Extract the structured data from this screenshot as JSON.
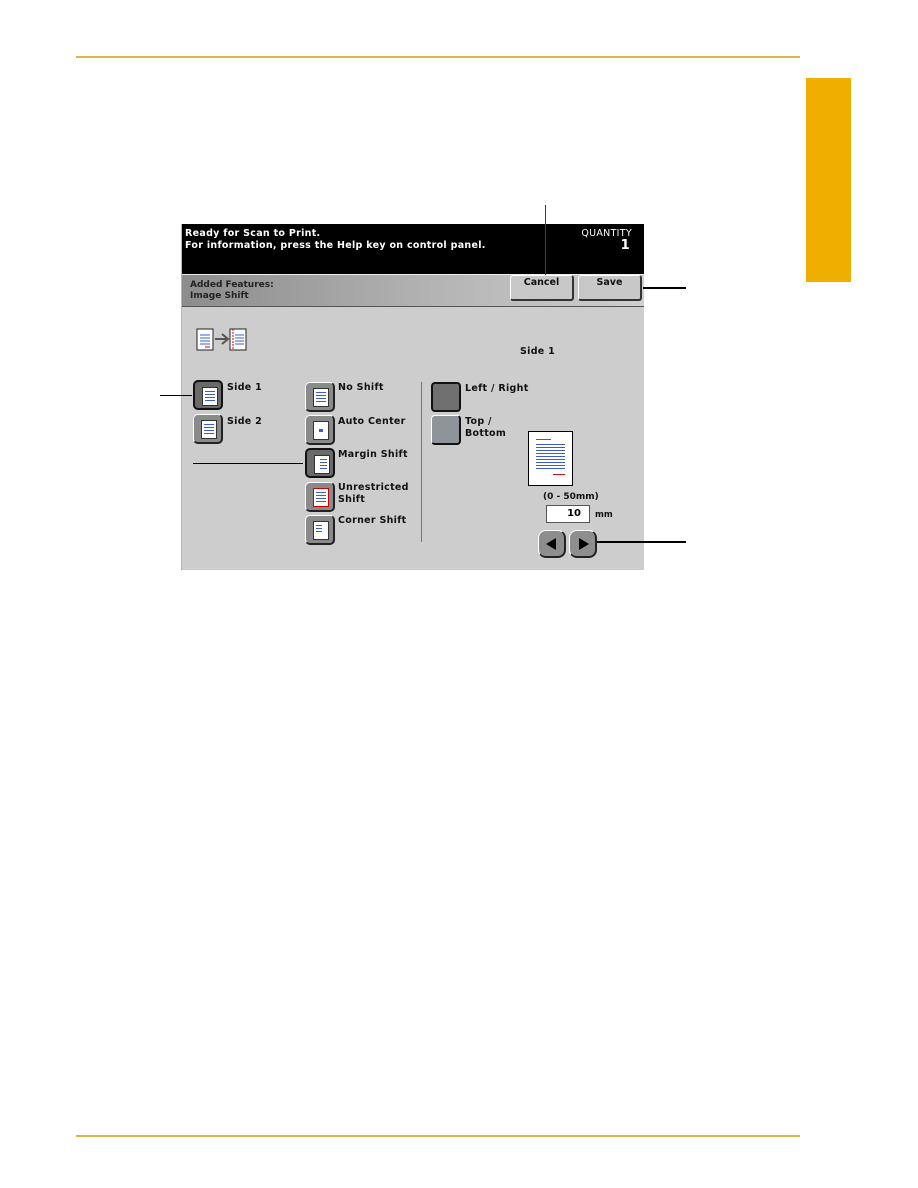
{
  "page": {
    "accent_color": "#efae00",
    "rule_color": "#d9b84a"
  },
  "screen": {
    "message_line1": "Ready  for  Scan  to  Print.",
    "message_line2": "For  information,  press  the  Help  key  on  control  panel.",
    "quantity_label": "QUANTITY",
    "quantity_value": "1",
    "title_line1": "Added  Features:",
    "title_line2": "Image  Shift",
    "cancel_label": "Cancel",
    "save_label": "Save",
    "feature_icon": "image-shift-icon",
    "current_side_label": "Side  1",
    "sides": [
      {
        "label": "Side  1",
        "icon": "side-1-doc-icon",
        "selected": true
      },
      {
        "label": "Side  2",
        "icon": "side-2-doc-icon",
        "selected": false
      }
    ],
    "shift_modes": [
      {
        "label": "No  Shift",
        "icon": "no-shift-icon",
        "selected": false
      },
      {
        "label": "Auto  Center",
        "icon": "auto-center-icon",
        "selected": false
      },
      {
        "label": "Margin  Shift",
        "icon": "margin-shift-icon",
        "selected": true
      },
      {
        "label": "Unrestricted Shift",
        "icon": "unrestricted-shift-icon",
        "selected": false
      },
      {
        "label": "Corner  Shift",
        "icon": "corner-shift-icon",
        "selected": false
      }
    ],
    "directions": [
      {
        "label": "Left  /  Right",
        "selected": true
      },
      {
        "label_line1": "Top  /",
        "label_line2": "Bottom",
        "selected": false
      }
    ],
    "range_label": "(0  -  50mm)",
    "margin_value": "10",
    "unit_label": "mm"
  }
}
